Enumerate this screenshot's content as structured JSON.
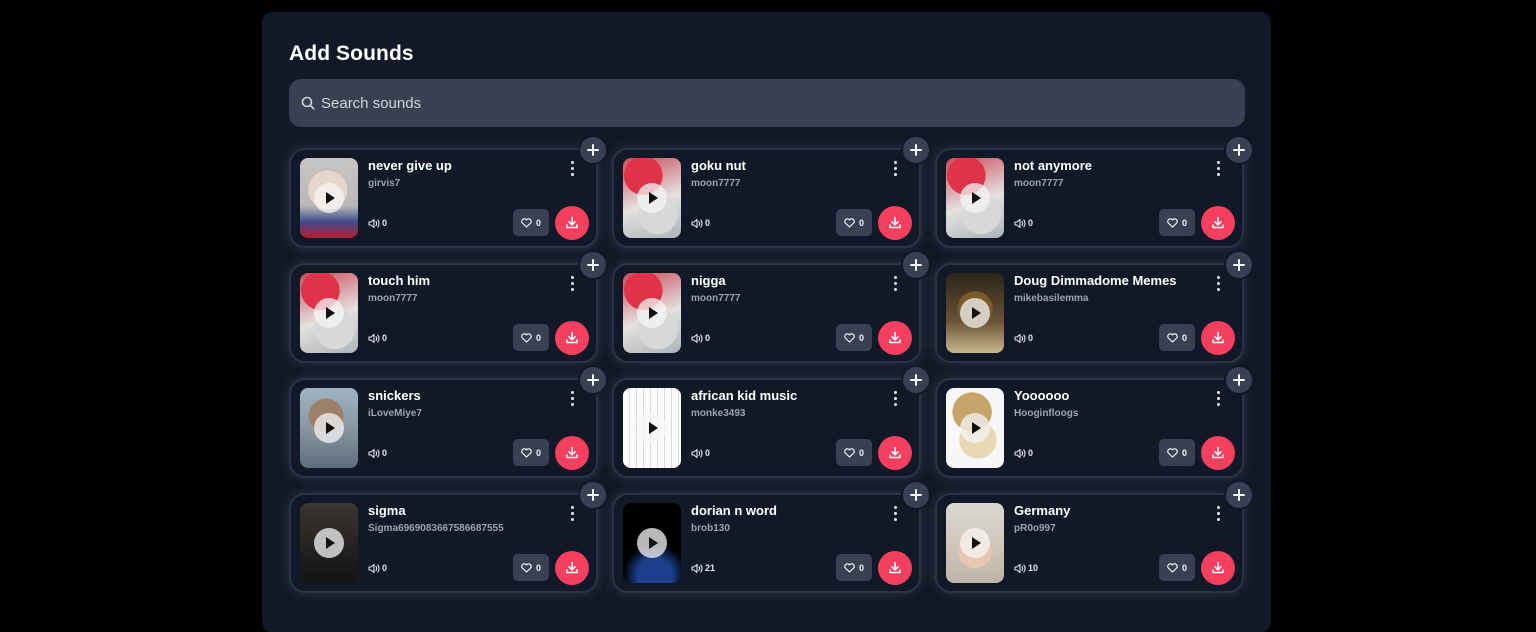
{
  "header": {
    "title": "Add Sounds"
  },
  "search": {
    "placeholder": "Search sounds",
    "value": ""
  },
  "colors": {
    "background": "#000000",
    "panel": "#111827",
    "input": "#374151",
    "accent_download": "#f43f5e"
  },
  "icons": {
    "search": "search-icon",
    "add": "plus-icon",
    "menu": "more-vertical-icon",
    "play": "play-icon",
    "plays": "volume-icon",
    "like": "heart-icon",
    "download": "download-icon"
  },
  "sounds": [
    {
      "name": "never give up",
      "author": "girvis7",
      "plays": "0",
      "likes": "0",
      "thumbnail": "bald man photo"
    },
    {
      "name": "goku nut",
      "author": "moon7777",
      "plays": "0",
      "likes": "0",
      "thumbnail": "red-haired anime character"
    },
    {
      "name": "not anymore",
      "author": "moon7777",
      "plays": "0",
      "likes": "0",
      "thumbnail": "red-haired anime character"
    },
    {
      "name": "touch him",
      "author": "moon7777",
      "plays": "0",
      "likes": "0",
      "thumbnail": "red-haired anime character"
    },
    {
      "name": "nigga",
      "author": "moon7777",
      "plays": "0",
      "likes": "0",
      "thumbnail": "red-haired anime character"
    },
    {
      "name": "Doug Dimmadome Memes",
      "author": "mikebasilemma",
      "plays": "0",
      "likes": "0",
      "thumbnail": "cartoon character"
    },
    {
      "name": "snickers",
      "author": "iLoveMiye7",
      "plays": "0",
      "likes": "0",
      "thumbnail": "baby monkey"
    },
    {
      "name": "african kid music",
      "author": "monke3493",
      "plays": "0",
      "likes": "0",
      "thumbnail": "sketch drawing"
    },
    {
      "name": "Yoooooo",
      "author": "Hooginfloogs",
      "plays": "0",
      "likes": "0",
      "thumbnail": "cat with straw hat"
    },
    {
      "name": "sigma",
      "author": "Sigma6969083667586687555",
      "plays": "0",
      "likes": "0",
      "thumbnail": "dark photo"
    },
    {
      "name": "dorian n word",
      "author": "brob130",
      "plays": "21",
      "likes": "0",
      "thumbnail": "black image"
    },
    {
      "name": "Germany",
      "author": "pR0o997",
      "plays": "10",
      "likes": "0",
      "thumbnail": "baby photo"
    }
  ]
}
